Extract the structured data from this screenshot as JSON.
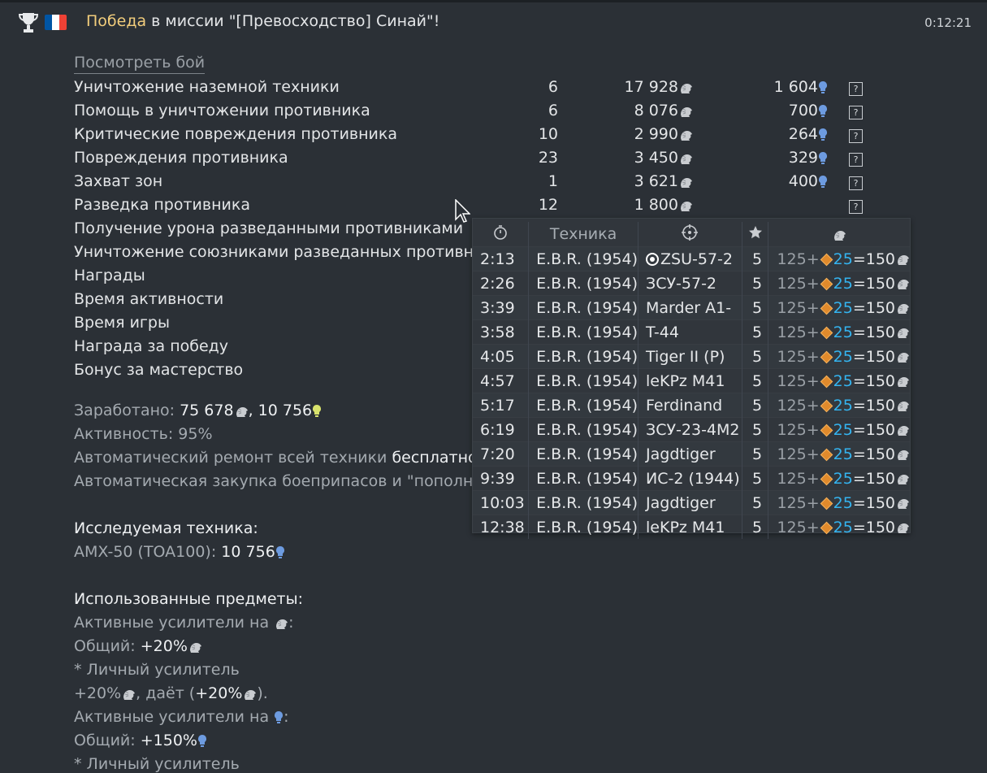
{
  "header": {
    "victory_word": "Победа",
    "mission_text": " в миссии \"[Превосходство] Синай\"!",
    "elapsed": "0:12:21",
    "flag_colors": [
      "#0055a4",
      "#ffffff",
      "#ef4135"
    ]
  },
  "view_battle_link": "Посмотреть бой",
  "rewards": [
    {
      "label": "Уничтожение наземной техники",
      "count": "6",
      "silver": "17 928",
      "rp": "1 604"
    },
    {
      "label": "Помощь в уничтожении противника",
      "count": "6",
      "silver": "8 076",
      "rp": "700"
    },
    {
      "label": "Критические повреждения противника",
      "count": "10",
      "silver": "2 990",
      "rp": "264"
    },
    {
      "label": "Повреждения противника",
      "count": "23",
      "silver": "3 450",
      "rp": "329"
    },
    {
      "label": "Захват зон",
      "count": "1",
      "silver": "3 621",
      "rp": "400"
    },
    {
      "label": "Разведка противника",
      "count": "12",
      "silver": "1 800",
      "rp": ""
    }
  ],
  "other_rows": [
    "Получение урона разведанными противниками",
    "Уничтожение союзниками разведанных противников",
    "Награды",
    "Время активности",
    "Время игры",
    "Награда за победу",
    "Бонус за мастерство"
  ],
  "summary": {
    "earned_label": "Заработано: ",
    "earned_silver": "75 678",
    "earned_rp": ", 10 756",
    "activity": "Активность: 95%",
    "repair_label": "Автоматический ремонт всей техники ",
    "repair_value": "бесплатно.",
    "ammo": "Автоматическая закупка боеприпасов и \"пополнения"
  },
  "research": {
    "heading": "Исследуемая техника:",
    "vehicle": "AMX-50 (TOA100): ",
    "rp": "10 756"
  },
  "items": {
    "heading": "Использованные предметы:",
    "silver_boosters": "Активные усилители на ",
    "general_label": "Общий: ",
    "general_silver": "+20%",
    "personal": "* Личный усилитель",
    "personal_val": "+20%",
    "gives": ", даёт (",
    "gives_val": "+20%",
    "close": ").",
    "rp_boosters": "Активные усилители на ",
    "colon": ":",
    "general_rp": "+150%",
    "personal2": "* Личный усилитель"
  },
  "tooltip": {
    "col_vehicle": "Техника",
    "rows": [
      {
        "time": "2:13",
        "vehicle": "E.B.R. (1954)",
        "target": "ZSU-57-2",
        "marked": true,
        "stars": "5",
        "base": "125",
        "bonus": "25",
        "total": "150"
      },
      {
        "time": "2:26",
        "vehicle": "E.B.R. (1954)",
        "target": "ЗСУ-57-2",
        "marked": false,
        "stars": "5",
        "base": "125",
        "bonus": "25",
        "total": "150"
      },
      {
        "time": "3:39",
        "vehicle": "E.B.R. (1954)",
        "target": "Marder A1-",
        "marked": false,
        "stars": "5",
        "base": "125",
        "bonus": "25",
        "total": "150"
      },
      {
        "time": "3:58",
        "vehicle": "E.B.R. (1954)",
        "target": "T-44",
        "marked": false,
        "stars": "5",
        "base": "125",
        "bonus": "25",
        "total": "150"
      },
      {
        "time": "4:05",
        "vehicle": "E.B.R. (1954)",
        "target": "Tiger II (P)",
        "marked": false,
        "stars": "5",
        "base": "125",
        "bonus": "25",
        "total": "150"
      },
      {
        "time": "4:57",
        "vehicle": "E.B.R. (1954)",
        "target": "leKPz M41",
        "marked": false,
        "stars": "5",
        "base": "125",
        "bonus": "25",
        "total": "150"
      },
      {
        "time": "5:17",
        "vehicle": "E.B.R. (1954)",
        "target": "Ferdinand",
        "marked": false,
        "stars": "5",
        "base": "125",
        "bonus": "25",
        "total": "150"
      },
      {
        "time": "6:19",
        "vehicle": "E.B.R. (1954)",
        "target": "ЗСУ-23-4М2",
        "marked": false,
        "stars": "5",
        "base": "125",
        "bonus": "25",
        "total": "150"
      },
      {
        "time": "7:20",
        "vehicle": "E.B.R. (1954)",
        "target": "Jagdtiger",
        "marked": false,
        "stars": "5",
        "base": "125",
        "bonus": "25",
        "total": "150"
      },
      {
        "time": "9:39",
        "vehicle": "E.B.R. (1954)",
        "target": "ИС-2 (1944)",
        "marked": false,
        "stars": "5",
        "base": "125",
        "bonus": "25",
        "total": "150"
      },
      {
        "time": "10:03",
        "vehicle": "E.B.R. (1954)",
        "target": "Jagdtiger",
        "marked": false,
        "stars": "5",
        "base": "125",
        "bonus": "25",
        "total": "150"
      },
      {
        "time": "12:38",
        "vehicle": "E.B.R. (1954)",
        "target": "leKPz M41",
        "marked": false,
        "stars": "5",
        "base": "125",
        "bonus": "25",
        "total": "150"
      }
    ]
  },
  "icons": {
    "silver": "lion-icon",
    "research": "bulb-icon",
    "help": "question-icon",
    "trophy": "trophy-icon",
    "clock": "stopwatch-icon",
    "target": "crosshair-icon",
    "star": "star-icon"
  },
  "colors": {
    "victory": "#f2cd7c",
    "rp_blue": "#6d9be0",
    "bonus_blue": "#34b4f0",
    "bulb_yellow": "#d8e26c"
  }
}
